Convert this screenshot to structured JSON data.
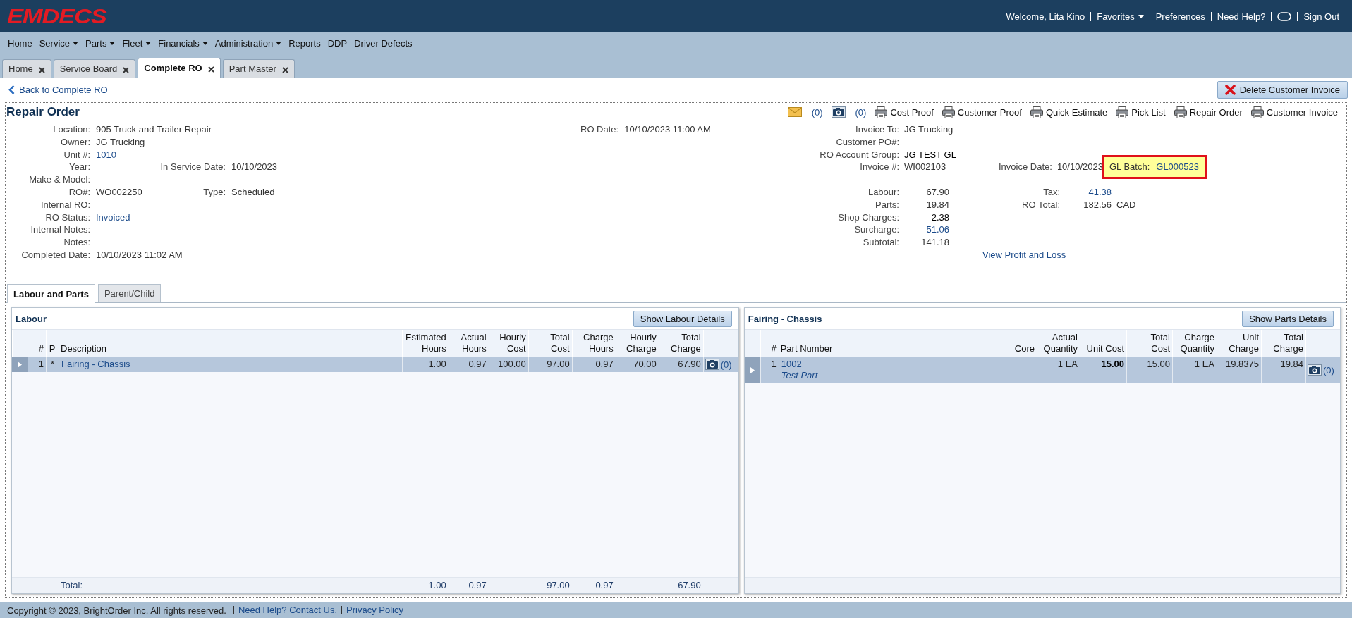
{
  "header": {
    "logo": "EMDECS",
    "user_links": [
      {
        "kind": "text",
        "label": "Welcome, Lita Kino"
      },
      {
        "kind": "dropdown",
        "label": "Favorites"
      },
      {
        "kind": "link",
        "label": "Preferences"
      },
      {
        "kind": "link",
        "label": "Need Help?"
      },
      {
        "kind": "icon"
      },
      {
        "kind": "link",
        "label": "Sign Out"
      }
    ]
  },
  "menu": [
    {
      "label": "Home",
      "dropdown": false
    },
    {
      "label": "Service",
      "dropdown": true
    },
    {
      "label": "Parts",
      "dropdown": true
    },
    {
      "label": "Fleet",
      "dropdown": true
    },
    {
      "label": "Financials",
      "dropdown": true
    },
    {
      "label": "Administration",
      "dropdown": true
    },
    {
      "label": "Reports",
      "dropdown": false
    },
    {
      "label": "DDP",
      "dropdown": false
    },
    {
      "label": "Driver Defects",
      "dropdown": false
    }
  ],
  "tabs": [
    {
      "label": "Home",
      "selected": false
    },
    {
      "label": "Service Board",
      "selected": false
    },
    {
      "label": "Complete RO",
      "selected": true
    },
    {
      "label": "Part Master",
      "selected": false
    }
  ],
  "back_link": "Back to Complete RO",
  "delete_button": "Delete Customer Invoice",
  "repair_order": {
    "title": "Repair Order",
    "toolbar": [
      {
        "kind": "mail",
        "label": "(0)"
      },
      {
        "kind": "camera",
        "label": "(0)"
      },
      {
        "kind": "print",
        "label": "Cost Proof"
      },
      {
        "kind": "print",
        "label": "Customer Proof"
      },
      {
        "kind": "print",
        "label": "Quick Estimate"
      },
      {
        "kind": "print",
        "label": "Pick List"
      },
      {
        "kind": "print",
        "label": "Repair Order"
      },
      {
        "kind": "print",
        "label": "Customer Invoice"
      }
    ],
    "fields": [
      {
        "label": "Location:",
        "value": "905 Truck and Trailer Repair",
        "link": false
      },
      {
        "label": "Owner:",
        "value": "JG Trucking",
        "link": false
      },
      {
        "label": "Unit #:",
        "value": "1010",
        "link": true
      },
      {
        "label": "Year:",
        "extra": {
          "label": "In Service Date:",
          "value": "10/10/2023"
        }
      },
      {
        "label": "Make & Model:"
      },
      {
        "label": "RO#:",
        "value": "WO002250",
        "link": false,
        "extra": {
          "label": "Type:",
          "value": "Scheduled"
        }
      },
      {
        "label": "Internal RO:"
      },
      {
        "label": "RO Status:",
        "value": "Invoiced",
        "link": true
      },
      {
        "label": "Internal Notes:"
      },
      {
        "label": "Notes:"
      },
      {
        "label": "Completed Date:",
        "value": "10/10/2023 11:02 AM",
        "link": false
      }
    ],
    "ro_date": {
      "label": "RO Date:",
      "value": "10/10/2023 11:00 AM"
    },
    "invoice_fields": [
      {
        "label": "Invoice To:",
        "value": "JG Trucking"
      },
      {
        "label": "Customer PO#:"
      },
      {
        "label": "RO Account Group:",
        "value": "JG TEST GL"
      },
      {
        "label": "Invoice #:",
        "value": "WI002103"
      }
    ],
    "invoice_date": {
      "label": "Invoice Date:",
      "value": "10/10/2023"
    },
    "gl_batch": {
      "label": "GL Batch:",
      "value": "GL000523",
      "highlighted": true
    },
    "totals": [
      {
        "label": "Labour:",
        "value": "67.90",
        "link": false
      },
      {
        "label": "Parts:",
        "value": "19.84",
        "link": false
      },
      {
        "label": "Shop Charges:",
        "value": "2.38",
        "link": false
      },
      {
        "label": "Surcharge:",
        "value": "51.06",
        "link": true
      },
      {
        "label": "Subtotal:",
        "value": "141.18",
        "link": false
      }
    ],
    "totals_right": [
      {
        "label": "Tax:",
        "value": "41.38",
        "link": true
      },
      {
        "label": "RO Total:",
        "value": "182.56",
        "link": false,
        "unit": "CAD"
      }
    ],
    "profit_loss_link": "View Profit and Loss"
  },
  "subtabs": [
    {
      "label": "Labour and Parts",
      "selected": true
    },
    {
      "label": "Parent/Child",
      "selected": false
    }
  ],
  "labour": {
    "title": "Labour",
    "button": "Show Labour Details",
    "columns": [
      "#",
      "P",
      "Description",
      "Estimated\nHours",
      "Actual\nHours",
      "Hourly\nCost",
      "Total\nCost",
      "Charge\nHours",
      "Hourly\nCharge",
      "Total\nCharge"
    ],
    "rows": [
      {
        "selected": true,
        "cells": [
          "1",
          "*",
          "Fairing - Chassis",
          "1.00",
          "0.97",
          "100.00",
          "97.00",
          "0.97",
          "70.00",
          "67.90"
        ],
        "photos": "(0)"
      }
    ],
    "totals": {
      "cells": [
        "",
        "",
        "Total:",
        "1.00",
        "0.97",
        "",
        "97.00",
        "0.97",
        "",
        "67.90"
      ]
    }
  },
  "parts": {
    "title": "Fairing - Chassis",
    "button": "Show Parts Details",
    "columns": [
      "#",
      "Part Number",
      "Core",
      "Actual\nQuantity",
      "Unit Cost",
      "Total\nCost",
      "Charge\nQuantity",
      "Unit\nCharge",
      "Total\nCharge"
    ],
    "rows": [
      {
        "selected": true,
        "cells": [
          "1",
          "1002",
          "",
          "1 EA",
          "15.00",
          "15.00",
          "1 EA",
          "19.8375",
          "19.84"
        ],
        "part_description": "Test Part",
        "photos": "(0)"
      }
    ]
  },
  "footer": {
    "copyright": "Copyright © 2023, BrightOrder Inc. All rights reserved.",
    "links": [
      "Need Help? Contact Us.",
      "Privacy Policy"
    ]
  }
}
